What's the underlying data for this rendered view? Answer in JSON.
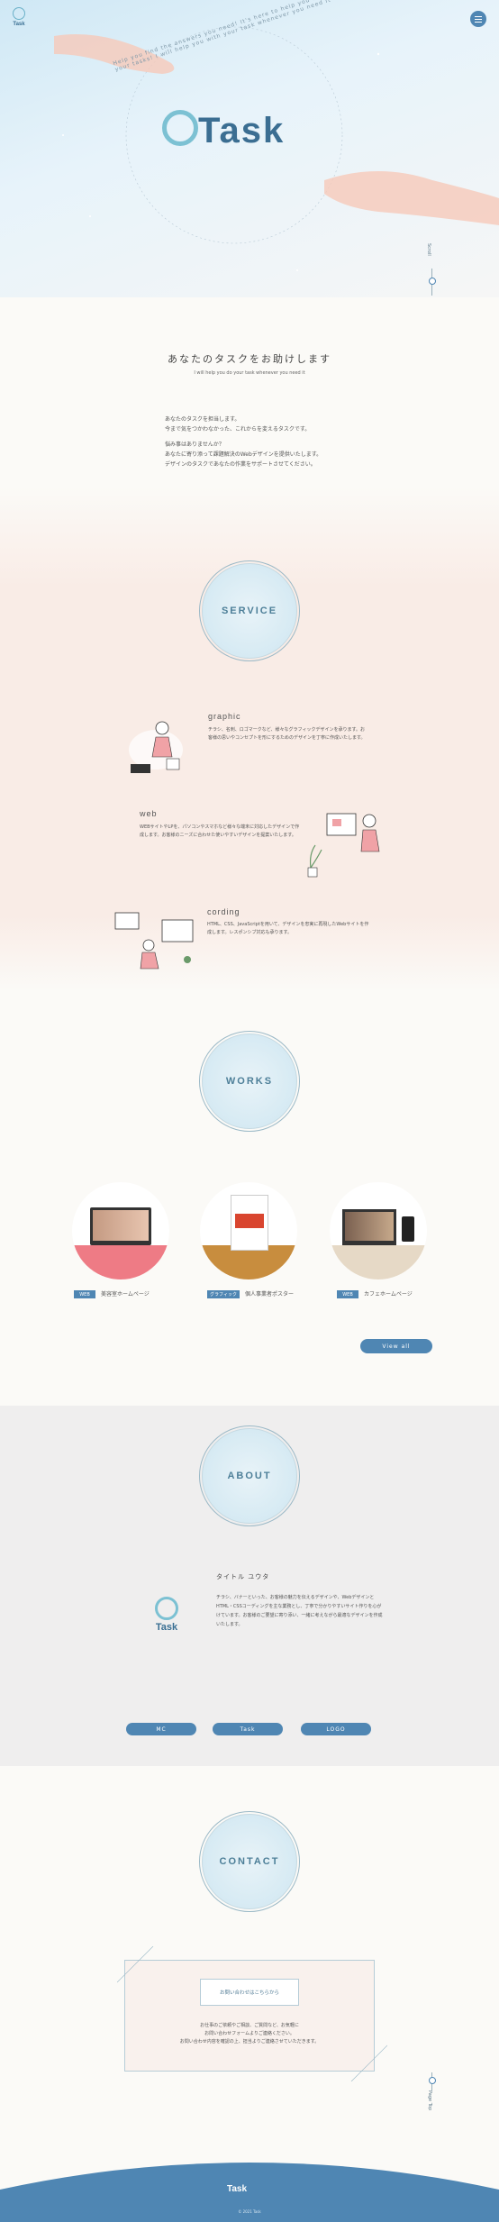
{
  "header": {
    "logo_small": "Task",
    "menu_icon": "menu-icon"
  },
  "hero": {
    "logo": "Task",
    "circle_text": "Help you find the answers you need! It's here to help you with all your tasks! I will help you with your task whenever you need it",
    "scroll_label": "Scroll"
  },
  "intro": {
    "heading": "あなたのタスクをお助けします",
    "subheading": "I will help you do your task whenever you need it",
    "lines": [
      "あなたのタスクを担当します。",
      "今まで気をつかわなかった、これからを変えるタスクです。",
      "悩み事はありませんか？",
      "あなたに寄り添って課題解決のWebデザインを提供いたします。",
      "デザインのタスクであなたの作業をサポートさせてください。"
    ]
  },
  "service": {
    "title": "SERVICE",
    "items": [
      {
        "name": "graphic",
        "text": "チラシ、名刺、ロゴマークなど、様々なグラフィックデザインを承ります。お客様の思いやコンセプトを形にするためのデザインを丁寧に作成いたします。"
      },
      {
        "name": "web",
        "text": "WEBサイトやLPを、パソコンやスマホなど様々な端末に対応したデザインで作成します。お客様のニーズに合わせた使いやすいデザインを提案いたします。"
      },
      {
        "name": "cording",
        "text": "HTML、CSS、JavaScriptを用いて、デザインを忠実に再現したWebサイトを作成します。レスポンシブ対応も承ります。"
      }
    ]
  },
  "works": {
    "title": "WORKS",
    "items": [
      {
        "tag": "WEB",
        "label": "美容室ホームページ"
      },
      {
        "tag": "グラフィック",
        "label": "個人事業者ポスター"
      },
      {
        "tag": "WEB",
        "label": "カフェホームページ"
      }
    ],
    "view_all": "View all"
  },
  "about": {
    "title": "ABOUT",
    "name": "タイトル ユウタ",
    "logo": "Task",
    "text": "チラシ、バナーといった、お客様の魅力を伝えるデザインや、WebデザインとHTML・CSSコーディングを主な業務とし、丁寧で分かりやすいサイト作りを心がけています。お客様のご要望に寄り添い、一緒に考えながら最適なデザインを作成いたします。",
    "buttons": [
      "MC",
      "Task",
      "LOGO"
    ]
  },
  "contact": {
    "title": "CONTACT",
    "button": "お問い合わせはこちらから",
    "lines": [
      "お仕事のご依頼やご相談、ご質問など、お気軽に",
      "お問い合わせフォームよりご連絡ください。",
      "お問い合わせ内容を確認の上、担当よりご連絡させていただきます。"
    ],
    "page_top": "Page Top"
  },
  "footer": {
    "logo": "Task",
    "copyright": "© 2021 Task"
  },
  "colors": {
    "accent": "#4f86b3",
    "pink": "#f9ece6",
    "sky": "#d6eaf3"
  }
}
